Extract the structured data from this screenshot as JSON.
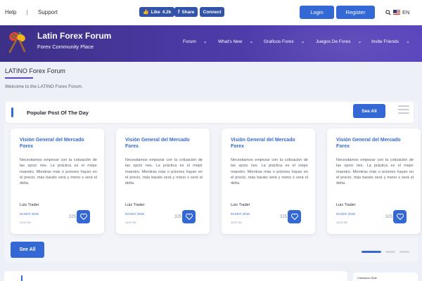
{
  "topbar": {
    "help": "Help",
    "separator": "|",
    "support": "Support",
    "like_label": "Like",
    "like_count": "4.2k",
    "share_label": "Share",
    "connect_label": "Connect",
    "login": "Login",
    "register": "Register",
    "language": "EN"
  },
  "banner": {
    "title": "Latin Forex Forum",
    "subtitle": "Forex Community Place",
    "nav": [
      {
        "label": "Forum"
      },
      {
        "label": "What's New"
      },
      {
        "label": "Graficos Forex"
      },
      {
        "label": "Juegos De Forex"
      },
      {
        "label": "Invite Friends"
      }
    ]
  },
  "page": {
    "title": "LATINO Forex Forum",
    "welcome": "Welcome to the LATINO Forex Forum."
  },
  "popular": {
    "title": "Popular Post Of The Day",
    "see_all": "See All",
    "see_all_bottom": "See All",
    "cards": [
      {
        "title": "Visión General del Mercado Forex",
        "body": "Necesitamos empezar con la cotización de las opcio nes. La práctica es el mejor maestro. Mientras más o pciones hayan en el precio, más barato será y meno s será el delta.",
        "author": "Luis Trader",
        "date": "04 MAY 2018",
        "time": "15:57:55",
        "likes": "325"
      },
      {
        "title": "Visión General del Mercado Forex",
        "body": "Necesitamos empezar con la cotización de las opcio nes. La práctica es el mejor maestro. Mientras más o pciones hayan en el precio, más barato será y meno s será el delta.",
        "author": "Luis Trader",
        "date": "04 MAY 2018",
        "time": "15:57:55",
        "likes": "325"
      },
      {
        "title": "Visión General del Mercado Forex",
        "body": "Necesitamos empezar con la cotización de las opcio nes. La práctica es el mejor maestro. Mientras más o pciones hayan en el precio, más barato será y meno s será el delta.",
        "author": "Luis Trader",
        "date": "04 MAY 2018",
        "time": "15:57:55",
        "likes": "325"
      },
      {
        "title": "Visión General del Mercado Forex",
        "body": "Necesitamos empezar con la cotización de las opcio nes. La práctica es el mejor maestro. Mientras más o pciones hayan en el precio, más barato será y meno s será el delta.",
        "author": "Luis Trader",
        "date": "04 MAY 2018",
        "time": "15:57:55",
        "likes": "325"
      }
    ]
  },
  "bottom": {
    "side_label": "Cotizacion Side"
  },
  "icons": {
    "like": "thumbs-up-icon",
    "share": "facebook-icon",
    "search": "search-icon",
    "flag": "us-flag-icon",
    "logo": "maracas-logo",
    "chevron": "chevron-down-icon",
    "menu": "hamburger-menu-icon",
    "heart": "heart-icon"
  },
  "colors": {
    "primary": "#3468d5",
    "banner_start": "#3c2f86",
    "banner_end": "#5a44bd",
    "facebook": "#3253a8",
    "background": "#edf0f6"
  }
}
